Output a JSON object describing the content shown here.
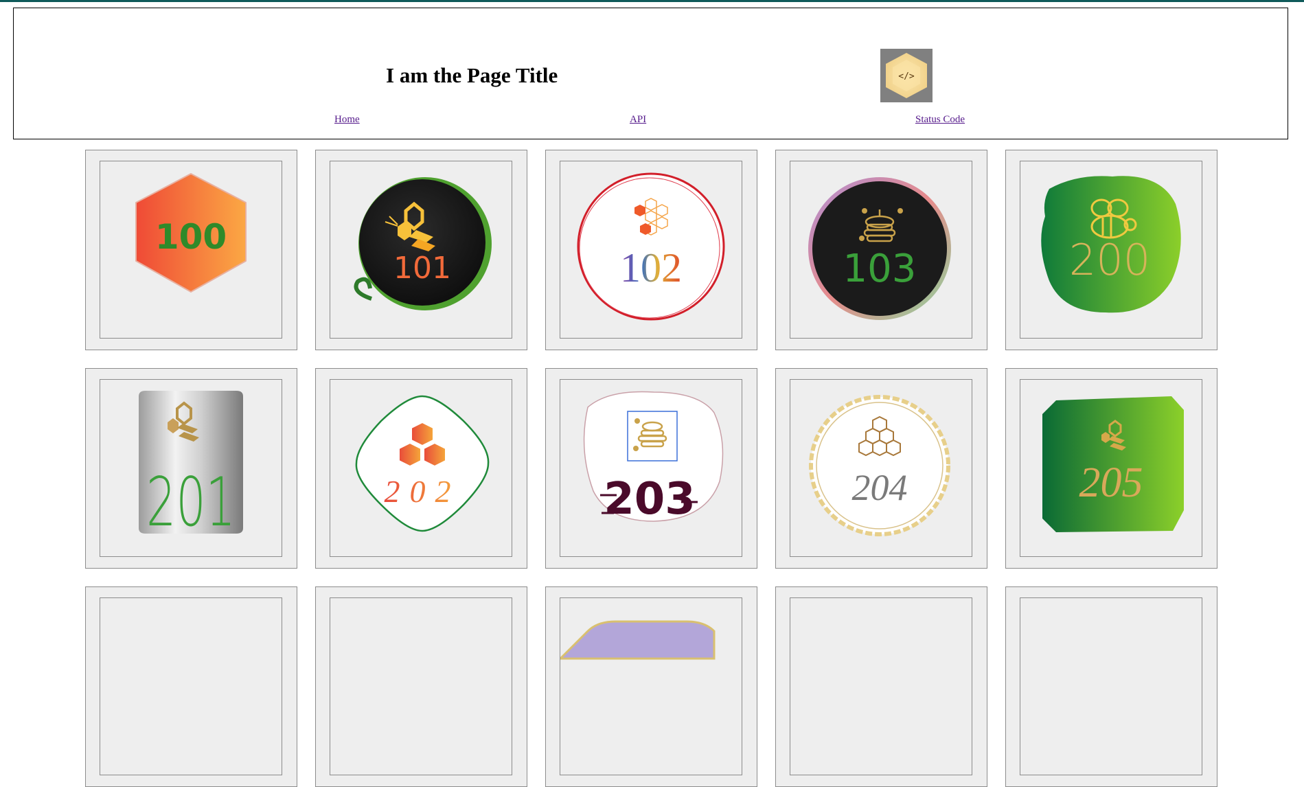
{
  "header": {
    "title": "I am the Page Title",
    "logo_glyph": "</>",
    "logo_icon": "code-hexagon-icon",
    "nav": [
      {
        "label": "Home"
      },
      {
        "label": "API"
      },
      {
        "label": "Status Code"
      }
    ]
  },
  "colors": {
    "top_bar": "#0f5a5a",
    "link": "#551a8b",
    "card_bg": "#eeeeee",
    "logo_bg": "#808080"
  },
  "cards": [
    {
      "code": "100",
      "icon": "hexagon-badge-icon"
    },
    {
      "code": "101",
      "icon": "bee-vine-badge-icon"
    },
    {
      "code": "102",
      "icon": "honeycomb-circle-badge-icon"
    },
    {
      "code": "103",
      "icon": "beehive-dark-badge-icon"
    },
    {
      "code": "200",
      "icon": "bee-green-blob-badge-icon"
    },
    {
      "code": "201",
      "icon": "silver-can-badge-icon"
    },
    {
      "code": "202",
      "icon": "honey-cells-rounded-badge-icon"
    },
    {
      "code": "203",
      "icon": "beehive-glitch-badge-icon"
    },
    {
      "code": "204",
      "icon": "honeycomb-scalloped-badge-icon"
    },
    {
      "code": "205",
      "icon": "bee-green-octagon-badge-icon"
    }
  ]
}
